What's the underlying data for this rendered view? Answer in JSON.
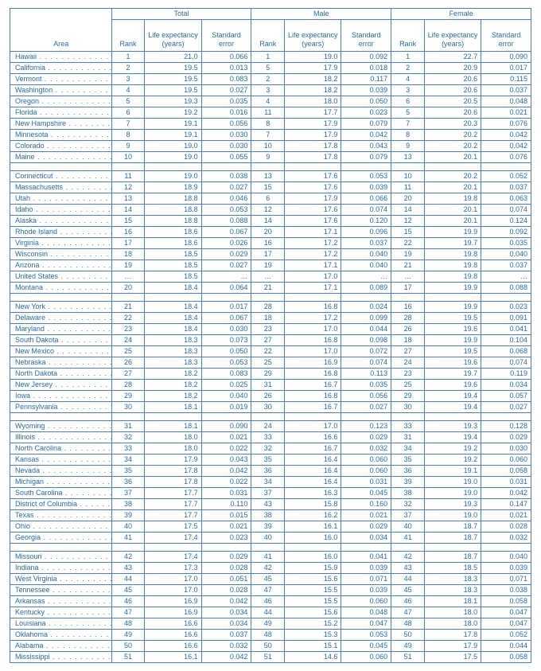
{
  "headers": {
    "area": "Area",
    "groups": [
      "Total",
      "Male",
      "Female"
    ],
    "sub": [
      "Rank",
      "Life expectancy (years)",
      "Standard error"
    ]
  },
  "groups": [
    [
      {
        "area": "Hawaii",
        "t": [
          "1",
          "21.0",
          "0.066"
        ],
        "m": [
          "1",
          "19.0",
          "0.092"
        ],
        "f": [
          "1",
          "22.7",
          "0.090"
        ]
      },
      {
        "area": "California",
        "t": [
          "2",
          "19.5",
          "0.013"
        ],
        "m": [
          "5",
          "17.9",
          "0.018"
        ],
        "f": [
          "2",
          "20.9",
          "0.017"
        ]
      },
      {
        "area": "Vermont",
        "t": [
          "3",
          "19.5",
          "0.083"
        ],
        "m": [
          "2",
          "18.2",
          "0.117"
        ],
        "f": [
          "4",
          "20.6",
          "0.115"
        ]
      },
      {
        "area": "Washington",
        "t": [
          "4",
          "19.5",
          "0.027"
        ],
        "m": [
          "3",
          "18.2",
          "0.039"
        ],
        "f": [
          "3",
          "20.6",
          "0.037"
        ]
      },
      {
        "area": "Oregon",
        "t": [
          "5",
          "19.3",
          "0.035"
        ],
        "m": [
          "4",
          "18.0",
          "0.050"
        ],
        "f": [
          "6",
          "20.5",
          "0.048"
        ]
      },
      {
        "area": "Florida",
        "t": [
          "6",
          "19.2",
          "0.016"
        ],
        "m": [
          "11",
          "17.7",
          "0.023"
        ],
        "f": [
          "5",
          "20.6",
          "0.021"
        ]
      },
      {
        "area": "New Hampshire",
        "t": [
          "7",
          "19.1",
          "0.056"
        ],
        "m": [
          "8",
          "17.9",
          "0.079"
        ],
        "f": [
          "7",
          "20.3",
          "0.076"
        ]
      },
      {
        "area": "Minnesota",
        "t": [
          "8",
          "19.1",
          "0.030"
        ],
        "m": [
          "7",
          "17.9",
          "0.042"
        ],
        "f": [
          "8",
          "20.2",
          "0.042"
        ]
      },
      {
        "area": "Colorado",
        "t": [
          "9",
          "19.0",
          "0.030"
        ],
        "m": [
          "10",
          "17.8",
          "0.043"
        ],
        "f": [
          "9",
          "20.2",
          "0.042"
        ]
      },
      {
        "area": "Maine",
        "t": [
          "10",
          "19.0",
          "0.055"
        ],
        "m": [
          "9",
          "17.8",
          "0.079"
        ],
        "f": [
          "13",
          "20.1",
          "0.076"
        ]
      }
    ],
    [
      {
        "area": "Connecticut",
        "t": [
          "11",
          "19.0",
          "0.038"
        ],
        "m": [
          "13",
          "17.6",
          "0.053"
        ],
        "f": [
          "10",
          "20.2",
          "0.052"
        ]
      },
      {
        "area": "Massachusetts",
        "t": [
          "12",
          "18.9",
          "0.027"
        ],
        "m": [
          "15",
          "17.6",
          "0.039"
        ],
        "f": [
          "11",
          "20.1",
          "0.037"
        ]
      },
      {
        "area": "Utah",
        "t": [
          "13",
          "18.8",
          "0.046"
        ],
        "m": [
          "6",
          "17.9",
          "0.066"
        ],
        "f": [
          "20",
          "19.8",
          "0.063"
        ]
      },
      {
        "area": "Idaho",
        "t": [
          "14",
          "18.8",
          "0.053"
        ],
        "m": [
          "12",
          "17.6",
          "0.074"
        ],
        "f": [
          "14",
          "20.1",
          "0.074"
        ]
      },
      {
        "area": "Alaska",
        "t": [
          "15",
          "18.8",
          "0.088"
        ],
        "m": [
          "14",
          "17.6",
          "0.120"
        ],
        "f": [
          "12",
          "20.1",
          "0.124"
        ]
      },
      {
        "area": "Rhode Island",
        "t": [
          "16",
          "18.6",
          "0.067"
        ],
        "m": [
          "20",
          "17.1",
          "0.096"
        ],
        "f": [
          "15",
          "19.9",
          "0.092"
        ]
      },
      {
        "area": "Virginia",
        "t": [
          "17",
          "18.6",
          "0.026"
        ],
        "m": [
          "16",
          "17.2",
          "0.037"
        ],
        "f": [
          "22",
          "19.7",
          "0.035"
        ]
      },
      {
        "area": "Wisconsin",
        "t": [
          "18",
          "18.5",
          "0.029"
        ],
        "m": [
          "17",
          "17.2",
          "0.040"
        ],
        "f": [
          "19",
          "19.8",
          "0.040"
        ]
      },
      {
        "area": "Arizona",
        "t": [
          "19",
          "18.5",
          "0.027"
        ],
        "m": [
          "19",
          "17.1",
          "0.040"
        ],
        "f": [
          "21",
          "19.8",
          "0.037"
        ]
      },
      {
        "area": "United States",
        "t": [
          "…",
          "18.5",
          "…"
        ],
        "m": [
          "…",
          "17.0",
          "…"
        ],
        "f": [
          "…",
          "19.8",
          "…"
        ]
      },
      {
        "area": "Montana",
        "t": [
          "20",
          "18.4",
          "0.064"
        ],
        "m": [
          "21",
          "17.1",
          "0.089"
        ],
        "f": [
          "17",
          "19.9",
          "0.088"
        ]
      }
    ],
    [
      {
        "area": "New York",
        "t": [
          "21",
          "18.4",
          "0.017"
        ],
        "m": [
          "28",
          "16.8",
          "0.024"
        ],
        "f": [
          "16",
          "19.9",
          "0.023"
        ]
      },
      {
        "area": "Delaware",
        "t": [
          "22",
          "18.4",
          "0.067"
        ],
        "m": [
          "18",
          "17.2",
          "0.099"
        ],
        "f": [
          "28",
          "19.5",
          "0.091"
        ]
      },
      {
        "area": "Maryland",
        "t": [
          "23",
          "18.4",
          "0.030"
        ],
        "m": [
          "23",
          "17.0",
          "0.044"
        ],
        "f": [
          "26",
          "19.6",
          "0.041"
        ]
      },
      {
        "area": "South Dakota",
        "t": [
          "24",
          "18.3",
          "0.073"
        ],
        "m": [
          "27",
          "16.8",
          "0.098"
        ],
        "f": [
          "18",
          "19.9",
          "0.104"
        ]
      },
      {
        "area": "New Mexico",
        "t": [
          "25",
          "18.3",
          "0.050"
        ],
        "m": [
          "22",
          "17.0",
          "0.072"
        ],
        "f": [
          "27",
          "19.5",
          "0.068"
        ]
      },
      {
        "area": "Nebraska",
        "t": [
          "26",
          "18.3",
          "0.053"
        ],
        "m": [
          "25",
          "16.9",
          "0.074"
        ],
        "f": [
          "24",
          "19.6",
          "0.074"
        ]
      },
      {
        "area": "North Dakota",
        "t": [
          "27",
          "18.2",
          "0.083"
        ],
        "m": [
          "29",
          "16.8",
          "0.113"
        ],
        "f": [
          "23",
          "19.7",
          "0.119"
        ]
      },
      {
        "area": "New Jersey",
        "t": [
          "28",
          "18.2",
          "0.025"
        ],
        "m": [
          "31",
          "16.7",
          "0.035"
        ],
        "f": [
          "25",
          "19.6",
          "0.034"
        ]
      },
      {
        "area": "Iowa",
        "t": [
          "29",
          "18.2",
          "0.040"
        ],
        "m": [
          "26",
          "16.8",
          "0.056"
        ],
        "f": [
          "29",
          "19.4",
          "0.057"
        ]
      },
      {
        "area": "Pennsylvania",
        "t": [
          "30",
          "18.1",
          "0.019"
        ],
        "m": [
          "30",
          "16.7",
          "0.027"
        ],
        "f": [
          "30",
          "19.4",
          "0.027"
        ]
      }
    ],
    [
      {
        "area": "Wyoming",
        "t": [
          "31",
          "18.1",
          "0.090"
        ],
        "m": [
          "24",
          "17.0",
          "0.123"
        ],
        "f": [
          "33",
          "19.3",
          "0.128"
        ]
      },
      {
        "area": "Illinois",
        "t": [
          "32",
          "18.0",
          "0.021"
        ],
        "m": [
          "33",
          "16.6",
          "0.029"
        ],
        "f": [
          "31",
          "19.4",
          "0.029"
        ]
      },
      {
        "area": "North Carolina",
        "t": [
          "33",
          "18.0",
          "0.022"
        ],
        "m": [
          "32",
          "16.7",
          "0.032"
        ],
        "f": [
          "34",
          "19.2",
          "0.030"
        ]
      },
      {
        "area": "Kansas",
        "t": [
          "34",
          "17.9",
          "0.043"
        ],
        "m": [
          "35",
          "16.4",
          "0.060"
        ],
        "f": [
          "35",
          "19.2",
          "0.060"
        ]
      },
      {
        "area": "Nevada",
        "t": [
          "35",
          "17.8",
          "0.042"
        ],
        "m": [
          "36",
          "16.4",
          "0.060"
        ],
        "f": [
          "36",
          "19.1",
          "0.058"
        ]
      },
      {
        "area": "Michigan",
        "t": [
          "36",
          "17.8",
          "0.022"
        ],
        "m": [
          "34",
          "16.4",
          "0.031"
        ],
        "f": [
          "39",
          "19.0",
          "0.031"
        ]
      },
      {
        "area": "South Carolina",
        "t": [
          "37",
          "17.7",
          "0.031"
        ],
        "m": [
          "37",
          "16.3",
          "0.045"
        ],
        "f": [
          "38",
          "19.0",
          "0.042"
        ]
      },
      {
        "area": "District of Columbia",
        "t": [
          "38",
          "17.7",
          "0.110"
        ],
        "m": [
          "43",
          "15.8",
          "0.160"
        ],
        "f": [
          "32",
          "19.3",
          "0.147"
        ]
      },
      {
        "area": "Texas",
        "t": [
          "39",
          "17.7",
          "0.015"
        ],
        "m": [
          "38",
          "16.2",
          "0.021"
        ],
        "f": [
          "37",
          "19.0",
          "0.021"
        ]
      },
      {
        "area": "Ohio",
        "t": [
          "40",
          "17.5",
          "0.021"
        ],
        "m": [
          "39",
          "16.1",
          "0.029"
        ],
        "f": [
          "40",
          "18.7",
          "0.028"
        ]
      },
      {
        "area": "Georgia",
        "t": [
          "41",
          "17.4",
          "0.023"
        ],
        "m": [
          "40",
          "16.0",
          "0.034"
        ],
        "f": [
          "41",
          "18.7",
          "0.032"
        ]
      }
    ],
    [
      {
        "area": "Missouri",
        "t": [
          "42",
          "17.4",
          "0.029"
        ],
        "m": [
          "41",
          "16.0",
          "0.041"
        ],
        "f": [
          "42",
          "18.7",
          "0.040"
        ]
      },
      {
        "area": "Indiana",
        "t": [
          "43",
          "17.3",
          "0.028"
        ],
        "m": [
          "42",
          "15.9",
          "0.039"
        ],
        "f": [
          "43",
          "18.5",
          "0.039"
        ]
      },
      {
        "area": "West Virginia",
        "t": [
          "44",
          "17.0",
          "0.051"
        ],
        "m": [
          "45",
          "15.6",
          "0.071"
        ],
        "f": [
          "44",
          "18.3",
          "0.071"
        ]
      },
      {
        "area": "Tennessee",
        "t": [
          "45",
          "17.0",
          "0.028"
        ],
        "m": [
          "47",
          "15.5",
          "0.039"
        ],
        "f": [
          "45",
          "18.3",
          "0.038"
        ]
      },
      {
        "area": "Arkansas",
        "t": [
          "46",
          "16.9",
          "0.042"
        ],
        "m": [
          "46",
          "15.5",
          "0.060"
        ],
        "f": [
          "46",
          "18.1",
          "0.058"
        ]
      },
      {
        "area": "Kentucky",
        "t": [
          "47",
          "16.9",
          "0.034"
        ],
        "m": [
          "44",
          "15.6",
          "0.048"
        ],
        "f": [
          "47",
          "18.0",
          "0.047"
        ]
      },
      {
        "area": "Louisiana",
        "t": [
          "48",
          "16.6",
          "0.034"
        ],
        "m": [
          "49",
          "15.2",
          "0.047"
        ],
        "f": [
          "48",
          "18.0",
          "0.047"
        ]
      },
      {
        "area": "Oklahoma",
        "t": [
          "49",
          "16.6",
          "0.037"
        ],
        "m": [
          "48",
          "15.3",
          "0.053"
        ],
        "f": [
          "50",
          "17.8",
          "0.052"
        ]
      },
      {
        "area": "Alabama",
        "t": [
          "50",
          "16.6",
          "0.032"
        ],
        "m": [
          "50",
          "15.1",
          "0.045"
        ],
        "f": [
          "49",
          "17.9",
          "0.044"
        ]
      },
      {
        "area": "Mississippi",
        "t": [
          "51",
          "16.1",
          "0.042"
        ],
        "m": [
          "51",
          "14.6",
          "0.060"
        ],
        "f": [
          "51",
          "17.5",
          "0.058"
        ]
      }
    ]
  ]
}
